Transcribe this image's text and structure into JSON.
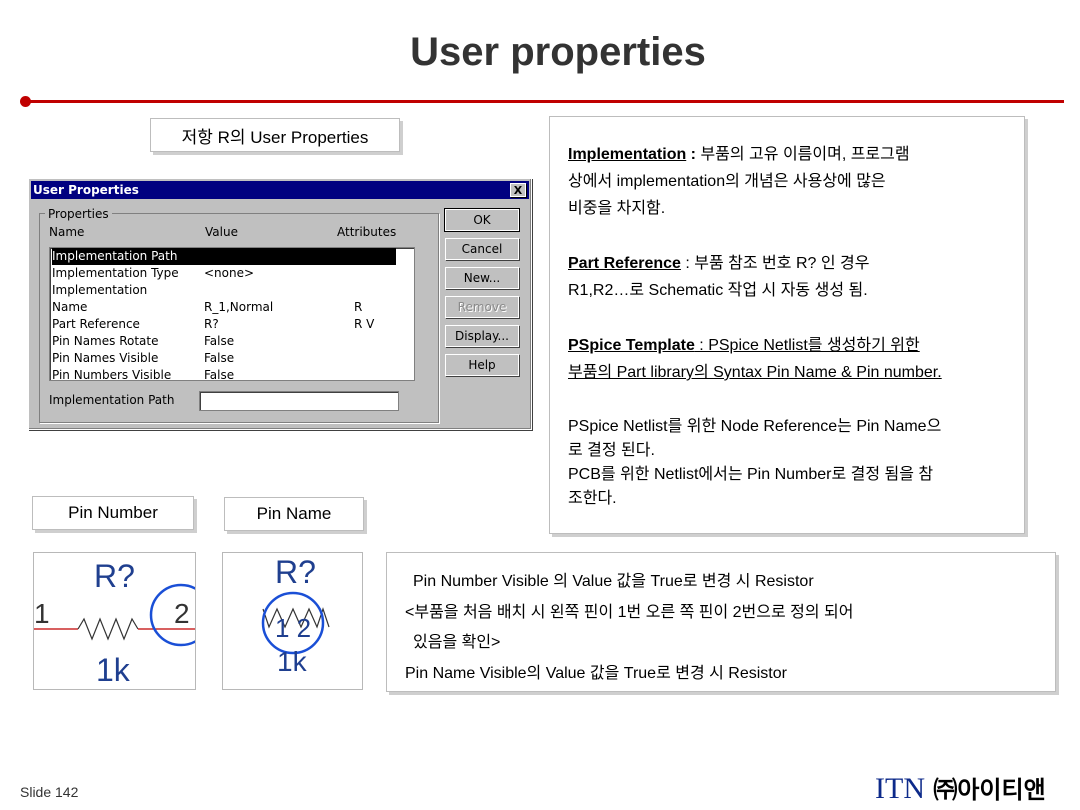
{
  "slide": {
    "title": "User properties",
    "slide_number": "Slide 142",
    "logo_text_en": "ITN",
    "logo_text_kr": "㈜아이티앤",
    "accent_color": "#c00000"
  },
  "captions": {
    "user_properties": "저항 R의 User Properties",
    "pin_number": "Pin Number",
    "pin_name": "Pin Name"
  },
  "dialog": {
    "title": "User Properties",
    "close_label": "X",
    "group_label": "Properties",
    "columns": [
      "Name",
      "Value",
      "Attributes"
    ],
    "rows": [
      {
        "name": "Implementation Path",
        "value": "",
        "attr": "",
        "selected": true
      },
      {
        "name": "Implementation Type",
        "value": "<none>",
        "attr": ""
      },
      {
        "name": "Implementation",
        "value": "",
        "attr": ""
      },
      {
        "name": "Name",
        "value": "R_1,Normal",
        "attr": "R"
      },
      {
        "name": "Part Reference",
        "value": "R?",
        "attr": "R V"
      },
      {
        "name": "Pin Names Rotate",
        "value": "False",
        "attr": ""
      },
      {
        "name": "Pin Names Visible",
        "value": "False",
        "attr": ""
      },
      {
        "name": "Pin Numbers Visible",
        "value": "False",
        "attr": ""
      }
    ],
    "field_label": "Implementation Path",
    "field_value": "",
    "buttons": {
      "ok": "OK",
      "cancel": "Cancel",
      "new": "New...",
      "remove": "Remove",
      "display": "Display...",
      "help": "Help"
    }
  },
  "info": {
    "impl_term": "Implementation",
    "impl_sep": " : ",
    "impl_line1": "부품의 고유 이름이며, 프로그램",
    "impl_line2": "상에서 implementation의 개념은 사용상에 많은",
    "impl_line3": "비중을 차지함.",
    "partref_term": "Part Reference",
    "partref_line1": " : 부품 참조 번호 R? 인 경우",
    "partref_line2": "R1,R2…로 Schematic 작업 시 자동 생성 됨.",
    "pspice_term": "PSpice Template",
    "pspice_line1": " : PSpice Netlist를 생성하기 위한",
    "pspice_line2": "부품의 Part library의 Syntax Pin Name & Pin number.",
    "node_line1": "PSpice Netlist를 위한 Node Reference는 Pin Name으",
    "node_line2": "로 결정 된다.",
    "pcb_line1": "PCB를 위한 Netlist에서는 Pin Number로 결정 됨을 참",
    "pcb_line2": "조한다."
  },
  "note": {
    "line1": "Pin Number Visible 의 Value 값을 True로 변경 시 Resistor",
    "line2": "<부품을 처음 배치 시 왼쪽 핀이 1번 오른 쪽 핀이 2번으로 정의 되어",
    "line3": "있음을 확인>",
    "line4": "Pin Name Visible의 Value 값을 True로 변경 시 Resistor"
  },
  "schematic_number": {
    "ref": "R?",
    "pin_left": "1",
    "pin_right": "2",
    "value": "1k"
  },
  "schematic_name": {
    "ref": "R?",
    "pin_names": "1 2",
    "value": "1k"
  }
}
